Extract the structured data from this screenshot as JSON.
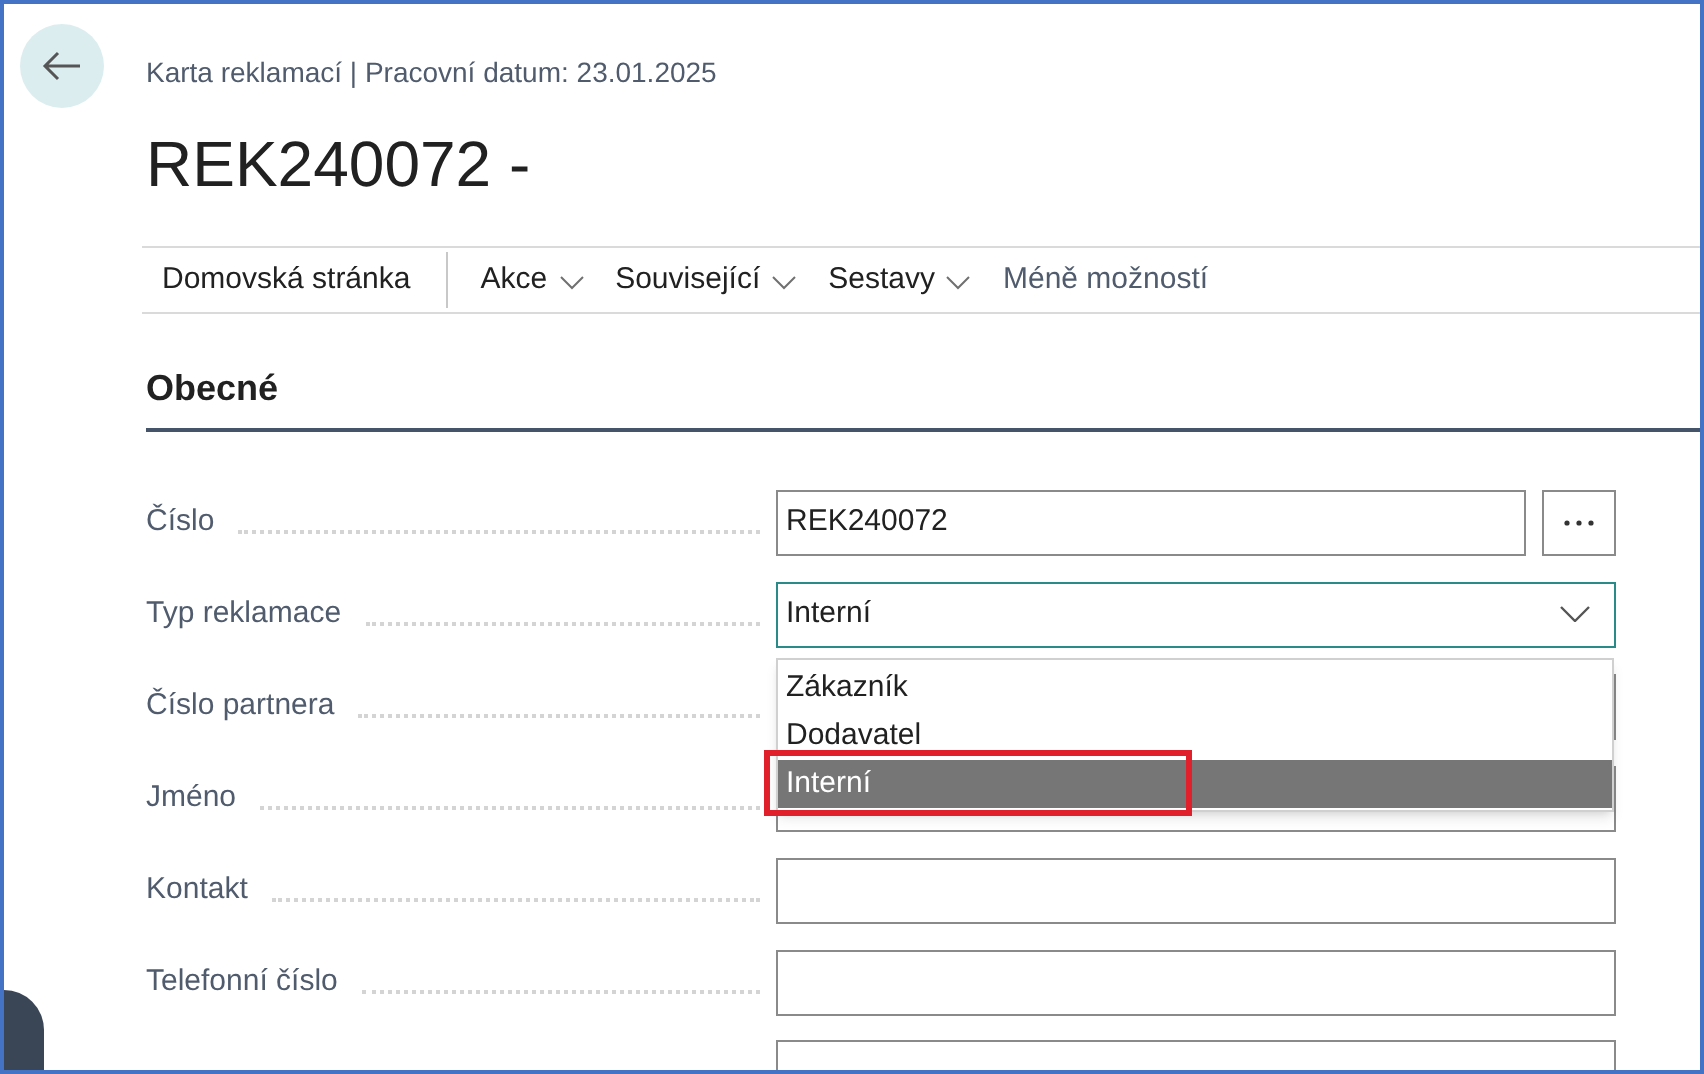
{
  "header": {
    "breadcrumb": "Karta reklamací | Pracovní datum: 23.01.2025",
    "title": "REK240072 -"
  },
  "actions": [
    {
      "label": "Domovská stránka",
      "kind": "home"
    },
    {
      "label": "Akce",
      "kind": "menu"
    },
    {
      "label": "Související",
      "kind": "menu"
    },
    {
      "label": "Sestavy",
      "kind": "menu"
    },
    {
      "label": "Méně možností",
      "kind": "link"
    }
  ],
  "section": {
    "title": "Obecné"
  },
  "fields": [
    {
      "label": "Číslo",
      "kind": "lookup",
      "value": "REK240072"
    },
    {
      "label": "Typ reklamace",
      "kind": "select",
      "value": "Interní"
    },
    {
      "label": "Číslo partnera",
      "kind": "text"
    },
    {
      "label": "Jméno",
      "kind": "text"
    },
    {
      "label": "Kontakt",
      "kind": "text"
    },
    {
      "label": "Telefonní číslo",
      "kind": "text"
    }
  ],
  "dropdown": {
    "options": [
      {
        "label": "Zákazník",
        "selected": false
      },
      {
        "label": "Dodavatel",
        "selected": false
      },
      {
        "label": "Interní",
        "selected": true
      }
    ]
  }
}
